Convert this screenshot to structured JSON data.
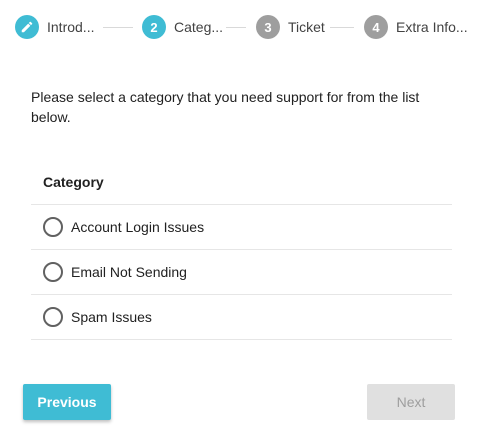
{
  "stepper": {
    "steps": [
      {
        "number": "",
        "label": "Introd...",
        "state": "done",
        "icon": "pencil-icon"
      },
      {
        "number": "2",
        "label": "Categ...",
        "state": "active"
      },
      {
        "number": "3",
        "label": "Ticket",
        "state": "inactive"
      },
      {
        "number": "4",
        "label": "Extra Info...",
        "state": "inactive"
      }
    ]
  },
  "intro": {
    "text": "Please select a category that you need support for from the list below."
  },
  "category": {
    "header": "Category",
    "options": [
      {
        "label": "Account Login Issues",
        "selected": false
      },
      {
        "label": "Email Not Sending",
        "selected": false
      },
      {
        "label": "Spam Issues",
        "selected": false
      }
    ]
  },
  "buttons": {
    "previous_label": "Previous",
    "next_label": "Next",
    "next_enabled": false
  },
  "colors": {
    "accent": "#3fbcd4",
    "inactive_step": "#9e9e9e",
    "disabled_button": "#e0e0e0"
  }
}
